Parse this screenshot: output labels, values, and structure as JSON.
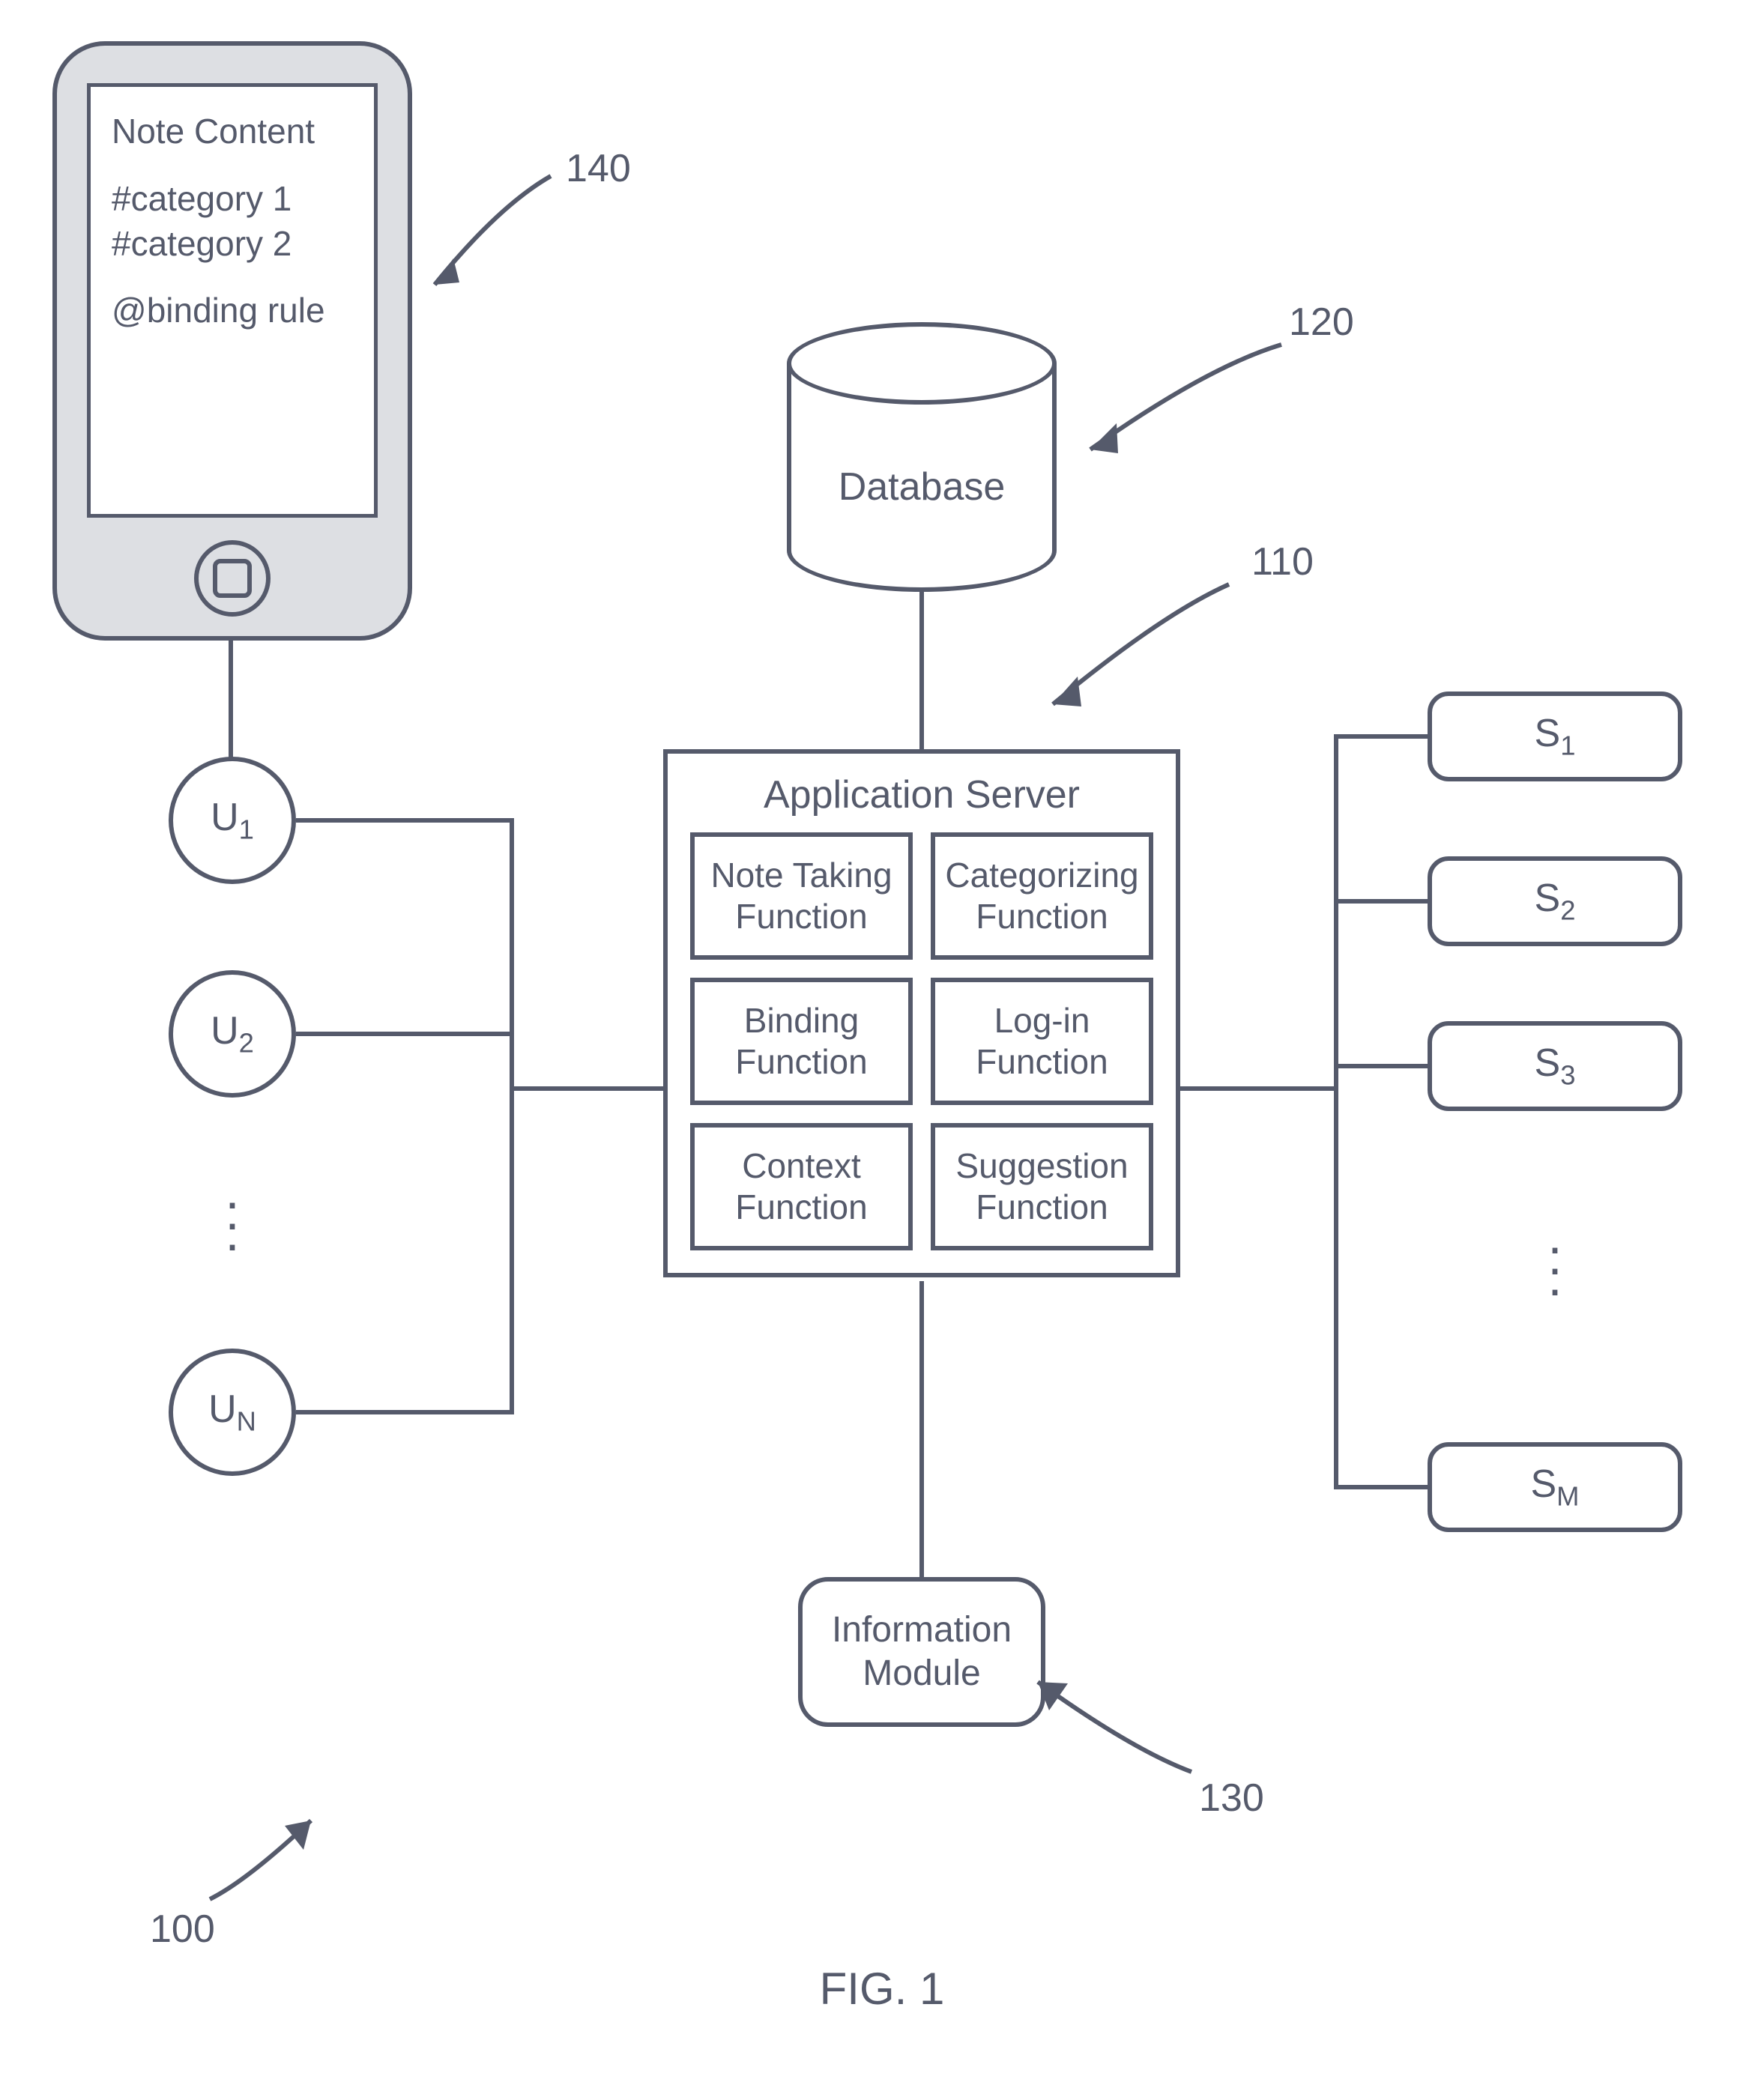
{
  "figure_label": "FIG. 1",
  "reference_numbers": {
    "system": "100",
    "server": "110",
    "database": "120",
    "info_module": "130",
    "device": "140"
  },
  "phone": {
    "line1": "Note Content",
    "line2": "#category 1",
    "line3": "#category 2",
    "line4": "@binding rule"
  },
  "database": {
    "label": "Database"
  },
  "users": {
    "u1": "U",
    "u1_sub": "1",
    "u2": "U",
    "u2_sub": "2",
    "un": "U",
    "un_sub": "N"
  },
  "server": {
    "title": "Application Server",
    "functions": [
      "Note Taking Function",
      "Categorizing Function",
      "Binding Function",
      "Log-in Function",
      "Context Function",
      "Suggestion Function"
    ]
  },
  "services": {
    "s1": "S",
    "s1_sub": "1",
    "s2": "S",
    "s2_sub": "2",
    "s3": "S",
    "s3_sub": "3",
    "sm": "S",
    "sm_sub": "M"
  },
  "info_module": {
    "label": "Information Module"
  }
}
